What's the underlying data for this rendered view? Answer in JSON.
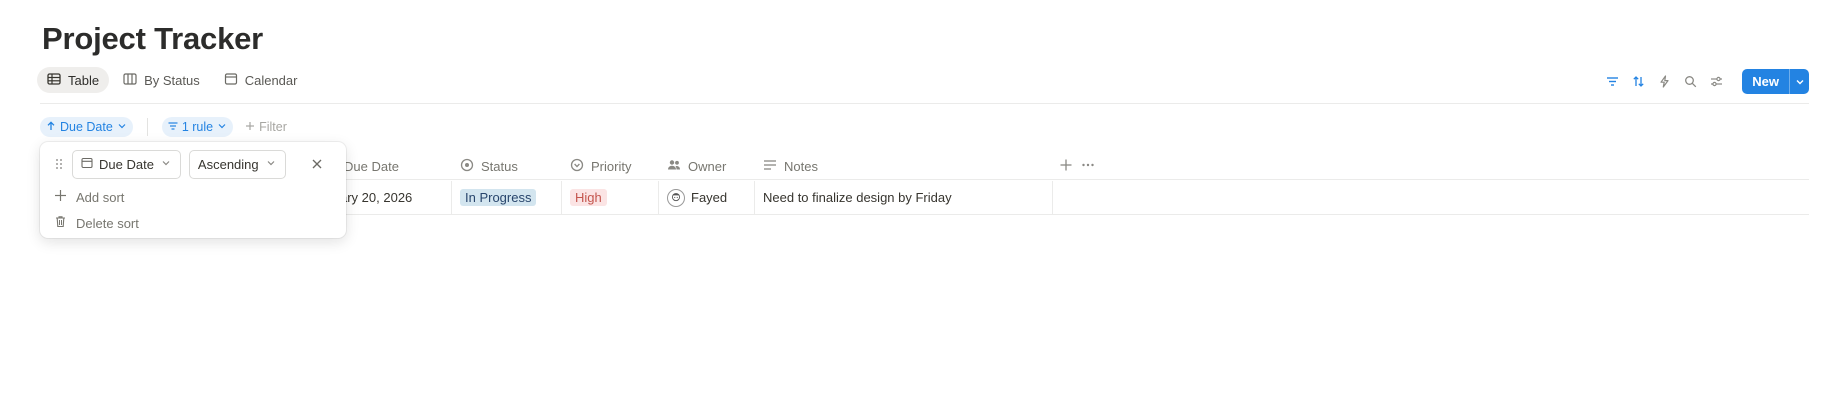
{
  "page": {
    "title": "Project Tracker"
  },
  "views": [
    {
      "label": "Table",
      "icon": "table-icon",
      "active": true
    },
    {
      "label": "By Status",
      "icon": "board-icon",
      "active": false
    },
    {
      "label": "Calendar",
      "icon": "calendar-icon",
      "active": false
    }
  ],
  "toolbar": {
    "new_label": "New"
  },
  "chips": {
    "sort_label": "Due Date",
    "rule_label": "1 rule",
    "add_filter_label": "Filter"
  },
  "table": {
    "columns": {
      "due_date": "Due Date",
      "status": "Status",
      "priority": "Priority",
      "owner": "Owner",
      "notes": "Notes"
    },
    "rows": [
      {
        "due_date": "ary 20, 2026",
        "status": "In Progress",
        "priority": "High",
        "owner": "Fayed",
        "notes": "Need to finalize design by Friday"
      }
    ]
  },
  "sort_popover": {
    "property": "Due Date",
    "direction": "Ascending",
    "add_sort": "Add sort",
    "delete_sort": "Delete sort"
  },
  "colors": {
    "accent": "#2383e2",
    "status_bg": "#d3e5ef",
    "priority_bg": "#fbe4e4"
  }
}
